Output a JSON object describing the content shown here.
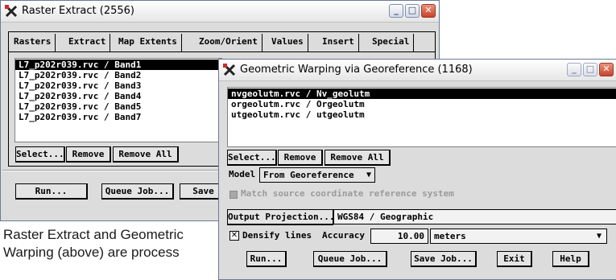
{
  "raster_extract": {
    "title": "Raster Extract (2556)",
    "tabs": [
      "Rasters",
      "Extract",
      "Map Extents",
      "Zoom/Orient",
      "Values",
      "Insert",
      "Special"
    ],
    "list": [
      "L7_p202r039.rvc / Band1",
      "L7_p202r039.rvc / Band2",
      "L7_p202r039.rvc / Band3",
      "L7_p202r039.rvc / Band4",
      "L7_p202r039.rvc / Band5",
      "L7_p202r039.rvc / Band7"
    ],
    "select_label": "Select...",
    "remove_label": "Remove",
    "remove_all_label": "Remove All",
    "run_label": "Run...",
    "queue_label": "Queue Job...",
    "save_label": "Save"
  },
  "warping": {
    "title": "Geometric Warping via Georeference (1168)",
    "list": [
      "nvgeolutm.rvc / Nv_geolutm",
      "orgeolutm.rvc / Orgeolutm",
      "utgeolutm.rvc / utgeolutm"
    ],
    "select_label": "Select...",
    "remove_label": "Remove",
    "remove_all_label": "Remove All",
    "model_label": "Model",
    "model_value": "From Georeference",
    "match_label": "Match source coordinate reference system",
    "output_projection_label": "Output Projection...",
    "output_projection_value": "WGS84 / Geographic",
    "densify_label": "Densify lines",
    "accuracy_label": "Accuracy",
    "accuracy_value": "10.00",
    "unit_value": "meters",
    "run_label": "Run...",
    "queue_label": "Queue Job...",
    "save_label": "Save Job...",
    "exit_label": "Exit",
    "help_label": "Help"
  },
  "caption": "Raster Extract and Geometric Warping (above) are process"
}
